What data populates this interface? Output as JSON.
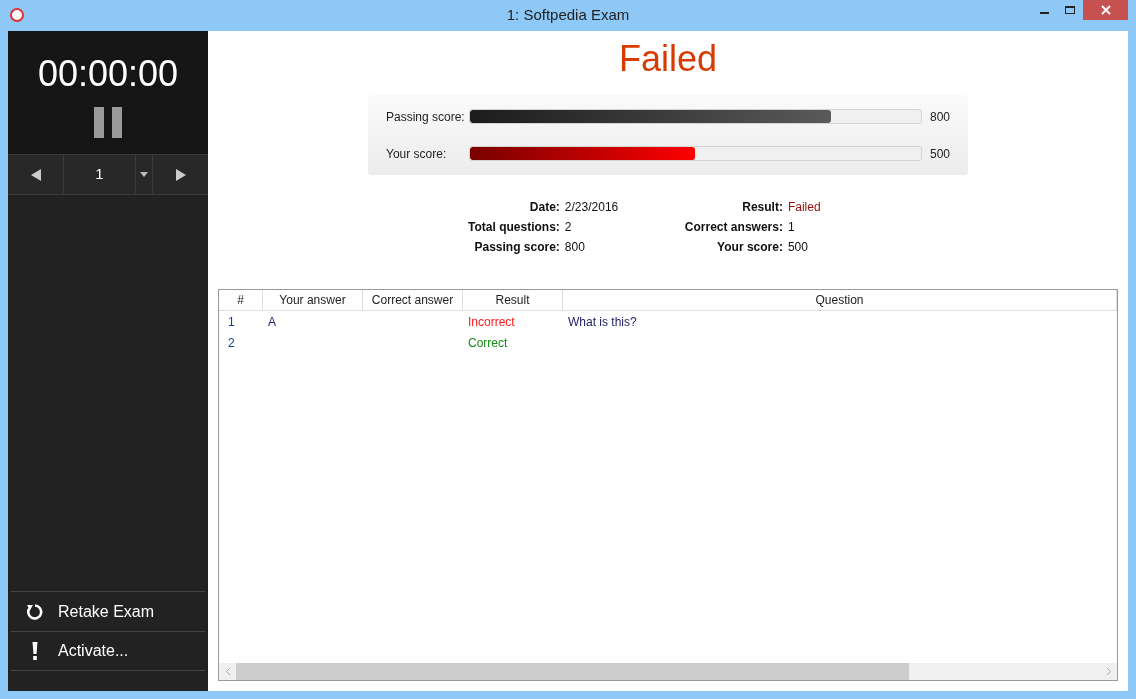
{
  "window": {
    "title": "1: Softpedia Exam"
  },
  "sidebar": {
    "timer": "00:00:00",
    "question_number": "1",
    "actions": [
      {
        "kind": "retake",
        "label": "Retake Exam"
      },
      {
        "kind": "activate",
        "label": "Activate..."
      }
    ]
  },
  "result_title": "Failed",
  "bars": [
    {
      "kind": "passing",
      "label": "Passing score:",
      "level": 0.8,
      "reading": "800"
    },
    {
      "kind": "yours",
      "label": "Your score:",
      "level": 0.5,
      "reading": "500"
    }
  ],
  "summary_left": [
    {
      "label": "Date:",
      "value": "2/23/2016"
    },
    {
      "label": "Total questions:",
      "value": "2"
    },
    {
      "label": "Passing score:",
      "value": "800"
    }
  ],
  "summary_right": [
    {
      "label": "Result:",
      "value": "Failed",
      "kind": "failed"
    },
    {
      "label": "Correct answers:",
      "value": "1",
      "kind": "plain"
    },
    {
      "label": "Your score:",
      "value": "500",
      "kind": "plain"
    }
  ],
  "table": {
    "columns": [
      "#",
      "Your answer",
      "Correct answer",
      "Result",
      "Question"
    ],
    "rows": [
      {
        "number": "1",
        "your_answer": "A",
        "correct_answer": "",
        "result": "Incorrect",
        "kind": "incorrect",
        "question": "What is this?"
      },
      {
        "number": "2",
        "your_answer": "",
        "correct_answer": "",
        "result": "Correct",
        "kind": "correct",
        "question": ""
      }
    ]
  }
}
